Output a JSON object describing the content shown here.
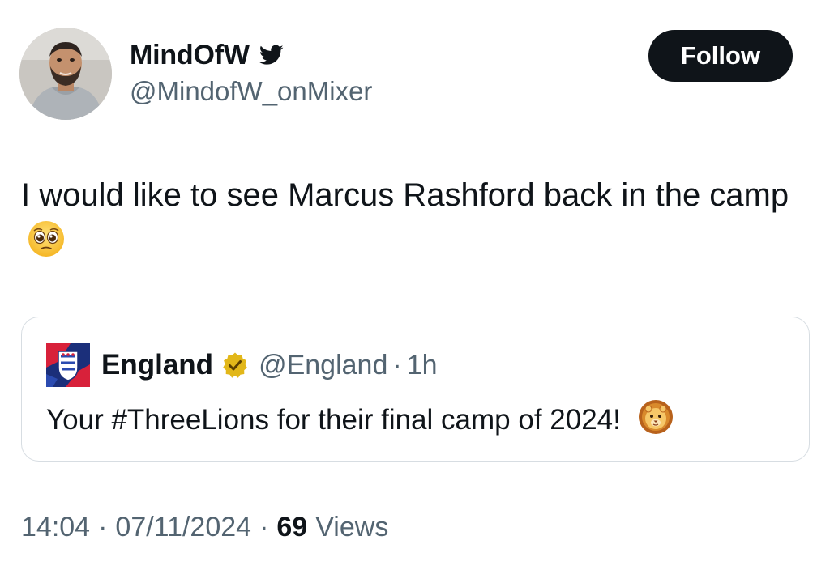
{
  "author": {
    "display_name": "MindOfW",
    "handle": "@MindofW_onMixer",
    "badge_icon": "twitter-bird-icon"
  },
  "follow_button": {
    "label": "Follow"
  },
  "tweet": {
    "text": "I would like to see Marcus Rashford back in the camp",
    "emoji": "pleading-face"
  },
  "quoted_tweet": {
    "display_name": "England",
    "verified_icon": "gold-verified-badge-icon",
    "handle": "@England",
    "separator": "·",
    "time": "1h",
    "text": "Your #ThreeLions for their final camp of 2024!",
    "emoji": "lion-face"
  },
  "meta": {
    "time": "14:04",
    "separator": "·",
    "date": "07/11/2024",
    "views_count": "69",
    "views_label": "Views"
  },
  "colors": {
    "text_primary": "#0f1419",
    "text_secondary": "#536471",
    "border": "#d7dde2",
    "button_bg": "#0f1419",
    "verified_gold": "#e2b719"
  }
}
